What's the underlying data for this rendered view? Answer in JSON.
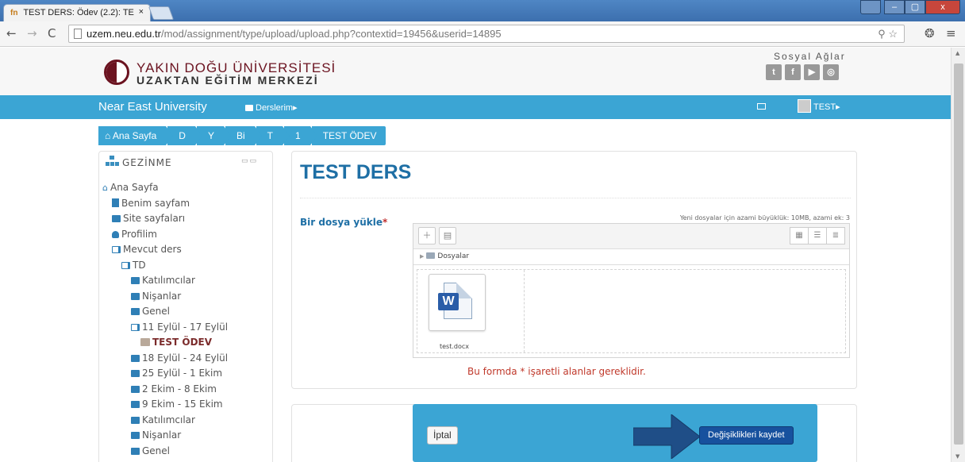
{
  "browser": {
    "tab_title": "TEST DERS: Ödev (2.2): TE",
    "tab_favicon": "fn",
    "tab_close": "×",
    "url_host": "uzem.neu.edu.tr",
    "url_path": "/mod/assignment/type/upload/upload.php?contextid=19456&userid=14895",
    "window_min": "–",
    "window_max": "▢",
    "window_close": "x"
  },
  "header": {
    "logo_line1": "YAKIN DOĞU ÜNİVERSİTESİ",
    "logo_line2": "UZAKTAN EĞİTİM MERKEZİ",
    "social_title": "Sosyal Ağlar",
    "social_icons": [
      "twitter-icon",
      "facebook-icon",
      "youtube-icon",
      "instagram-icon"
    ],
    "social_glyphs": [
      "t",
      "f",
      "▶",
      "◎"
    ]
  },
  "navbar": {
    "brand": "Near East University",
    "courses_link": "Derslerim",
    "user_name": "TEST",
    "caret": "▸"
  },
  "breadcrumb": {
    "items": [
      "Ana Sayfa",
      "D",
      "Y",
      "Bi",
      "T",
      "1",
      "TEST ÖDEV"
    ]
  },
  "navigation": {
    "title": "GEZİNME",
    "items": [
      {
        "label": "Ana Sayfa",
        "icon": "home-icon"
      },
      {
        "label": "Benim sayfam",
        "icon": "page-icon"
      },
      {
        "label": "Site sayfaları",
        "icon": "folder-icon"
      },
      {
        "label": "Profilim",
        "icon": "person-icon"
      },
      {
        "label": "Mevcut ders",
        "icon": "folder-open-icon"
      },
      {
        "label": "TD",
        "icon": "folder-open-icon"
      },
      {
        "label": "Katılımcılar",
        "icon": "folder-icon"
      },
      {
        "label": "Nişanlar",
        "icon": "folder-icon"
      },
      {
        "label": "Genel",
        "icon": "folder-icon"
      },
      {
        "label": "11 Eylül - 17 Eylül",
        "icon": "folder-open-icon"
      },
      {
        "label": "TEST ÖDEV",
        "icon": "assignment-icon"
      },
      {
        "label": "18 Eylül - 24 Eylül",
        "icon": "folder-icon"
      },
      {
        "label": "25 Eylül - 1 Ekim",
        "icon": "folder-icon"
      },
      {
        "label": "2 Ekim - 8 Ekim",
        "icon": "folder-icon"
      },
      {
        "label": "9 Ekim - 15 Ekim",
        "icon": "folder-icon"
      },
      {
        "label": "Katılımcılar",
        "icon": "folder-icon"
      },
      {
        "label": "Nişanlar",
        "icon": "folder-icon"
      },
      {
        "label": "Genel",
        "icon": "folder-icon"
      }
    ]
  },
  "main": {
    "course_title": "TEST DERS",
    "upload_label": "Bir dosya yükle",
    "required_mark": "*",
    "max_info": "Yeni dosyalar için azami büyüklük: 10MB, azami ek: 3",
    "folder_label": "Dosyalar",
    "file_name": "test.docx",
    "required_note": "Bu formda * işaretli alanlar gereklidir."
  },
  "actions": {
    "cancel": "İptal",
    "save": "Değişiklikleri kaydet"
  },
  "colors": {
    "accent": "#3ba5d4",
    "title_blue": "#1e6fa5",
    "logo_maroon": "#6b1320",
    "save_button": "#17519e",
    "required_red": "#c0392b"
  }
}
